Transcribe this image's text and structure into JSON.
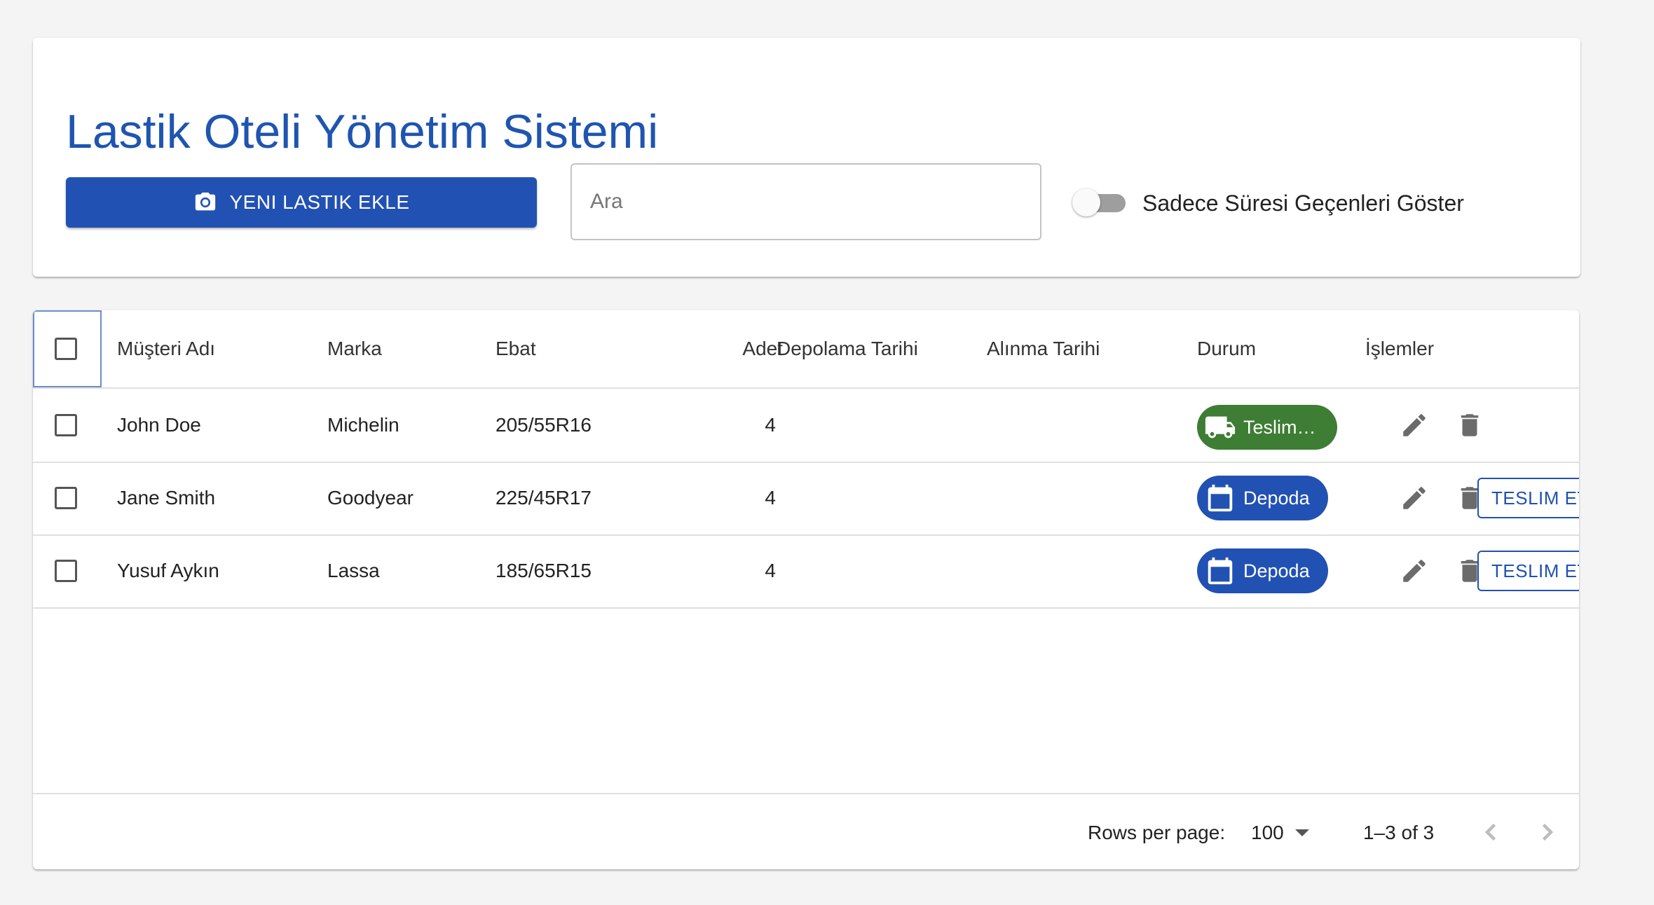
{
  "header": {
    "title": "Lastik Oteli Yönetim Sistemi",
    "add_button_label": "YENI LASTIK EKLE",
    "add_button_icon": "camera-icon",
    "search_placeholder": "Ara",
    "search_value": "",
    "toggle_label": "Sadece Süresi Geçenleri Göster",
    "toggle_on": false
  },
  "table": {
    "columns": {
      "customer": "Müşteri Adı",
      "brand": "Marka",
      "size": "Ebat",
      "quantity": "Adet",
      "storage_date": "Depolama Tarihi",
      "pickup_date": "Alınma Tarihi",
      "status": "Durum",
      "actions": "İşlemler"
    },
    "rows": [
      {
        "customer": "John Doe",
        "brand": "Michelin",
        "size": "205/55R16",
        "quantity": "4",
        "storage_date": "",
        "pickup_date": "",
        "status": "Teslim…",
        "status_icon": "truck-icon",
        "status_color": "#3e7d34",
        "action_label": ""
      },
      {
        "customer": "Jane Smith",
        "brand": "Goodyear",
        "size": "225/45R17",
        "quantity": "4",
        "storage_date": "",
        "pickup_date": "",
        "status": "Depoda",
        "status_icon": "calendar-icon",
        "status_color": "#2151b3",
        "action_label": "TESLIM ET"
      },
      {
        "customer": "Yusuf Aykın",
        "brand": "Lassa",
        "size": "185/65R15",
        "quantity": "4",
        "storage_date": "",
        "pickup_date": "",
        "status": "Depoda",
        "status_icon": "calendar-icon",
        "status_color": "#2151b3",
        "action_label": "TESLIM ET"
      }
    ],
    "footer": {
      "rows_per_page_label": "Rows per page:",
      "rows_per_page_value": "100",
      "range_text": "1–3 of 3"
    }
  },
  "colors": {
    "primary": "#2151b3",
    "title": "#1f55b0",
    "delivered": "#3e7d34"
  }
}
